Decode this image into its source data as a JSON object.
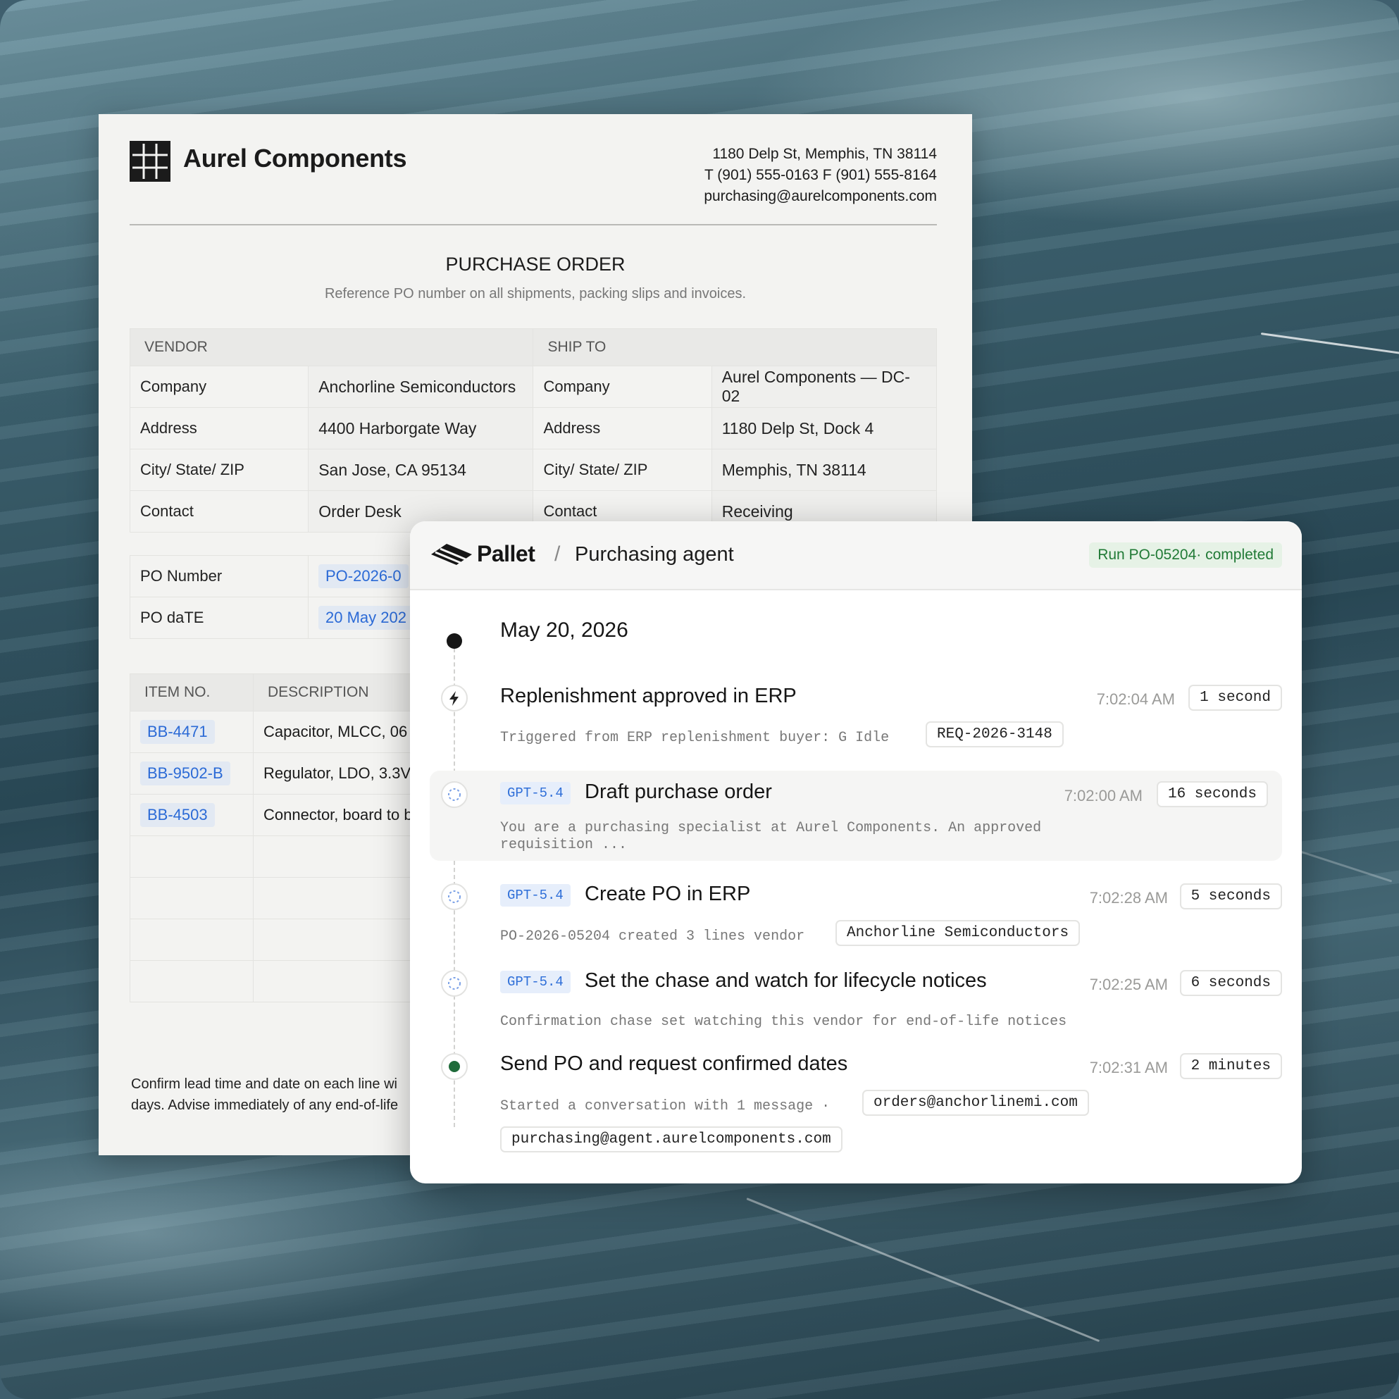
{
  "po": {
    "company": "Aurel Components",
    "address_line": "1180 Delp St, Memphis, TN 38114",
    "phone_line": "T (901) 555-0163 F (901) 555-8164",
    "email": "purchasing@aurelcomponents.com",
    "title": "PURCHASE ORDER",
    "subtitle": "Reference PO number on all shipments, packing slips and invoices.",
    "vendor_header": "VENDOR",
    "ship_header": "SHIP TO",
    "rows": [
      {
        "label": "Company",
        "vendor": "Anchorline Semiconductors",
        "ship_label": "Company",
        "ship": "Aurel Components — DC-02"
      },
      {
        "label": "Address",
        "vendor": "4400 Harborgate Way",
        "ship_label": "Address",
        "ship": "1180 Delp St, Dock 4"
      },
      {
        "label": "City/ State/ ZIP",
        "vendor": "San Jose, CA 95134",
        "ship_label": "City/ State/ ZIP",
        "ship": "Memphis, TN 38114"
      },
      {
        "label": "Contact",
        "vendor": "Order Desk",
        "ship_label": "Contact",
        "ship": "Receiving"
      }
    ],
    "po_number_label": "PO Number",
    "po_number_value": "PO-2026-0",
    "po_date_label": "PO daTE",
    "po_date_value": "20 May 202",
    "items_header_no": "ITEM NO.",
    "items_header_desc": "DESCRIPTION",
    "items": [
      {
        "no": "BB-4471",
        "desc": "Capacitor, MLCC, 06"
      },
      {
        "no": "BB-9502-B",
        "desc": "Regulator, LDO, 3.3V,"
      },
      {
        "no": "BB-4503",
        "desc": "Connector, board to b"
      }
    ],
    "footer_line1": "Confirm lead time and date on each line wi",
    "footer_line2": "days. Advise immediately of any end-of-life"
  },
  "agent": {
    "brand": "Pallet",
    "separator": "/",
    "page": "Purchasing agent",
    "status": "Run PO-05204· completed",
    "date": "May 20, 2026",
    "events": [
      {
        "title": "Replenishment approved in ERP",
        "time": "7:02:04 AM",
        "duration": "1 second",
        "desc": "Triggered from ERP replenishment buyer: G Idle",
        "chip": "REQ-2026-3148"
      },
      {
        "model": "GPT-5.4",
        "title": "Draft purchase order",
        "time": "7:02:00 AM",
        "duration": "16 seconds",
        "desc1": "You are a purchasing specialist at Aurel Components. An approved",
        "desc2": "requisition ..."
      },
      {
        "model": "GPT-5.4",
        "title": "Create PO in ERP",
        "time": "7:02:28 AM",
        "duration": "5 seconds",
        "desc": "PO-2026-05204 created 3 lines vendor",
        "chip": "Anchorline Semiconductors"
      },
      {
        "model": "GPT-5.4",
        "title": "Set the chase and watch for lifecycle notices",
        "time": "7:02:25 AM",
        "duration": "6 seconds",
        "desc": "Confirmation chase set watching this vendor for end-of-life notices"
      },
      {
        "title": "Send PO and request confirmed dates",
        "time": "7:02:31 AM",
        "duration": "2 minutes",
        "desc": "Started a conversation with 1 message ·",
        "chip": "orders@anchorlinemi.com",
        "chip2": "purchasing@agent.aurelcomponents.com"
      }
    ]
  },
  "colors": {
    "accent_blue": "#2f6fd8",
    "status_green": "#217a36",
    "ink": "#161616"
  }
}
